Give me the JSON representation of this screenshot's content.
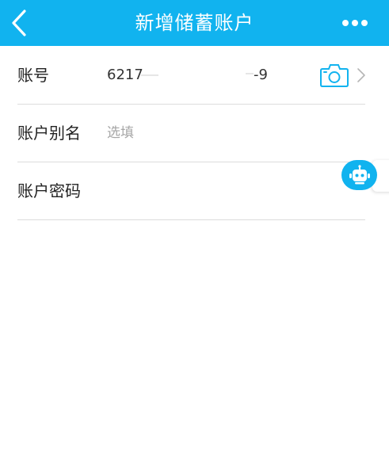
{
  "header": {
    "title": "新增储蓄账户",
    "background_color": "#11b3ef",
    "back_icon": "chevron-left-icon",
    "more_icon": "more-dots-icon"
  },
  "form": {
    "account": {
      "label": "账号",
      "value_prefix": "6217",
      "value_suffix": "-9",
      "camera_icon": "camera-icon",
      "chevron_icon": "chevron-right-icon"
    },
    "alias": {
      "label": "账户别名",
      "placeholder": "选填",
      "value": ""
    },
    "password": {
      "label": "账户密码",
      "value": ""
    }
  },
  "assistant": {
    "icon": "robot-icon",
    "color": "#11b3ef"
  }
}
